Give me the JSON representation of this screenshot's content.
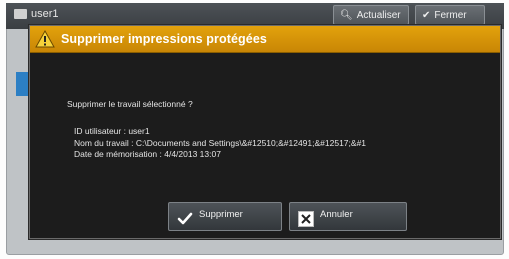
{
  "background": {
    "user_label": "user1",
    "refresh_label": "Actualiser",
    "close_label": "Fermer",
    "side_colon": ":"
  },
  "dialog": {
    "title": "Supprimer impressions protégées",
    "question": "Supprimer le travail sélectionné ?",
    "details": [
      "ID utilisateur : user1",
      "Nom du travail : C:\\Documents and Settings\\&#12510;&#12491;&#12517;&#1",
      "Date de mémorisation : 4/4/2013 13:07"
    ],
    "delete_label": "Supprimer",
    "cancel_label": "Annuler"
  },
  "colors": {
    "title_bar": "#d99507",
    "dialog_bg": "#1c1c1c",
    "button_bg": "#3f4347"
  }
}
